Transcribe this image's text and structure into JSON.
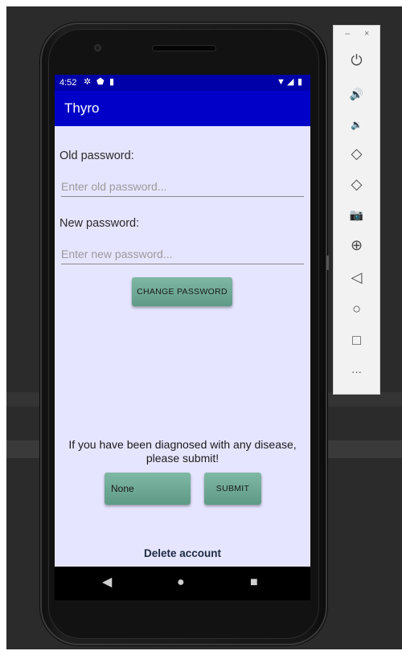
{
  "statusbar": {
    "time": "4:52",
    "icons_left": [
      "gear-icon",
      "shield-icon",
      "sd-card-icon"
    ],
    "icons_right": [
      "wifi-icon",
      "signal-icon",
      "battery-icon"
    ]
  },
  "app": {
    "title": "Thyro"
  },
  "form": {
    "old_label": "Old password:",
    "old_placeholder": "Enter old password...",
    "new_label": "New password:",
    "new_placeholder": "Enter new password...",
    "change_button": "CHANGE PASSWORD"
  },
  "disease": {
    "prompt_line1": "If you have been diagnosed with any disease,",
    "prompt_line2": "please submit!",
    "selected": "None",
    "submit_button": "SUBMIT"
  },
  "delete_account": "Delete account",
  "navbar": {
    "back": "◀",
    "home": "●",
    "recents": "■"
  },
  "toolbar": {
    "minimize": "–",
    "close": "×",
    "items": [
      {
        "name": "power-icon",
        "glyph": "⏻"
      },
      {
        "name": "volume-up-icon",
        "glyph": "🔊"
      },
      {
        "name": "volume-down-icon",
        "glyph": "🔉"
      },
      {
        "name": "rotate-left-icon",
        "glyph": "◇"
      },
      {
        "name": "rotate-right-icon",
        "glyph": "◇"
      },
      {
        "name": "camera-icon",
        "glyph": "📷"
      },
      {
        "name": "zoom-icon",
        "glyph": "⊕"
      },
      {
        "name": "back-icon",
        "glyph": "◁"
      },
      {
        "name": "home-icon",
        "glyph": "○"
      },
      {
        "name": "overview-icon",
        "glyph": "□"
      },
      {
        "name": "more-icon",
        "glyph": "···"
      }
    ]
  }
}
